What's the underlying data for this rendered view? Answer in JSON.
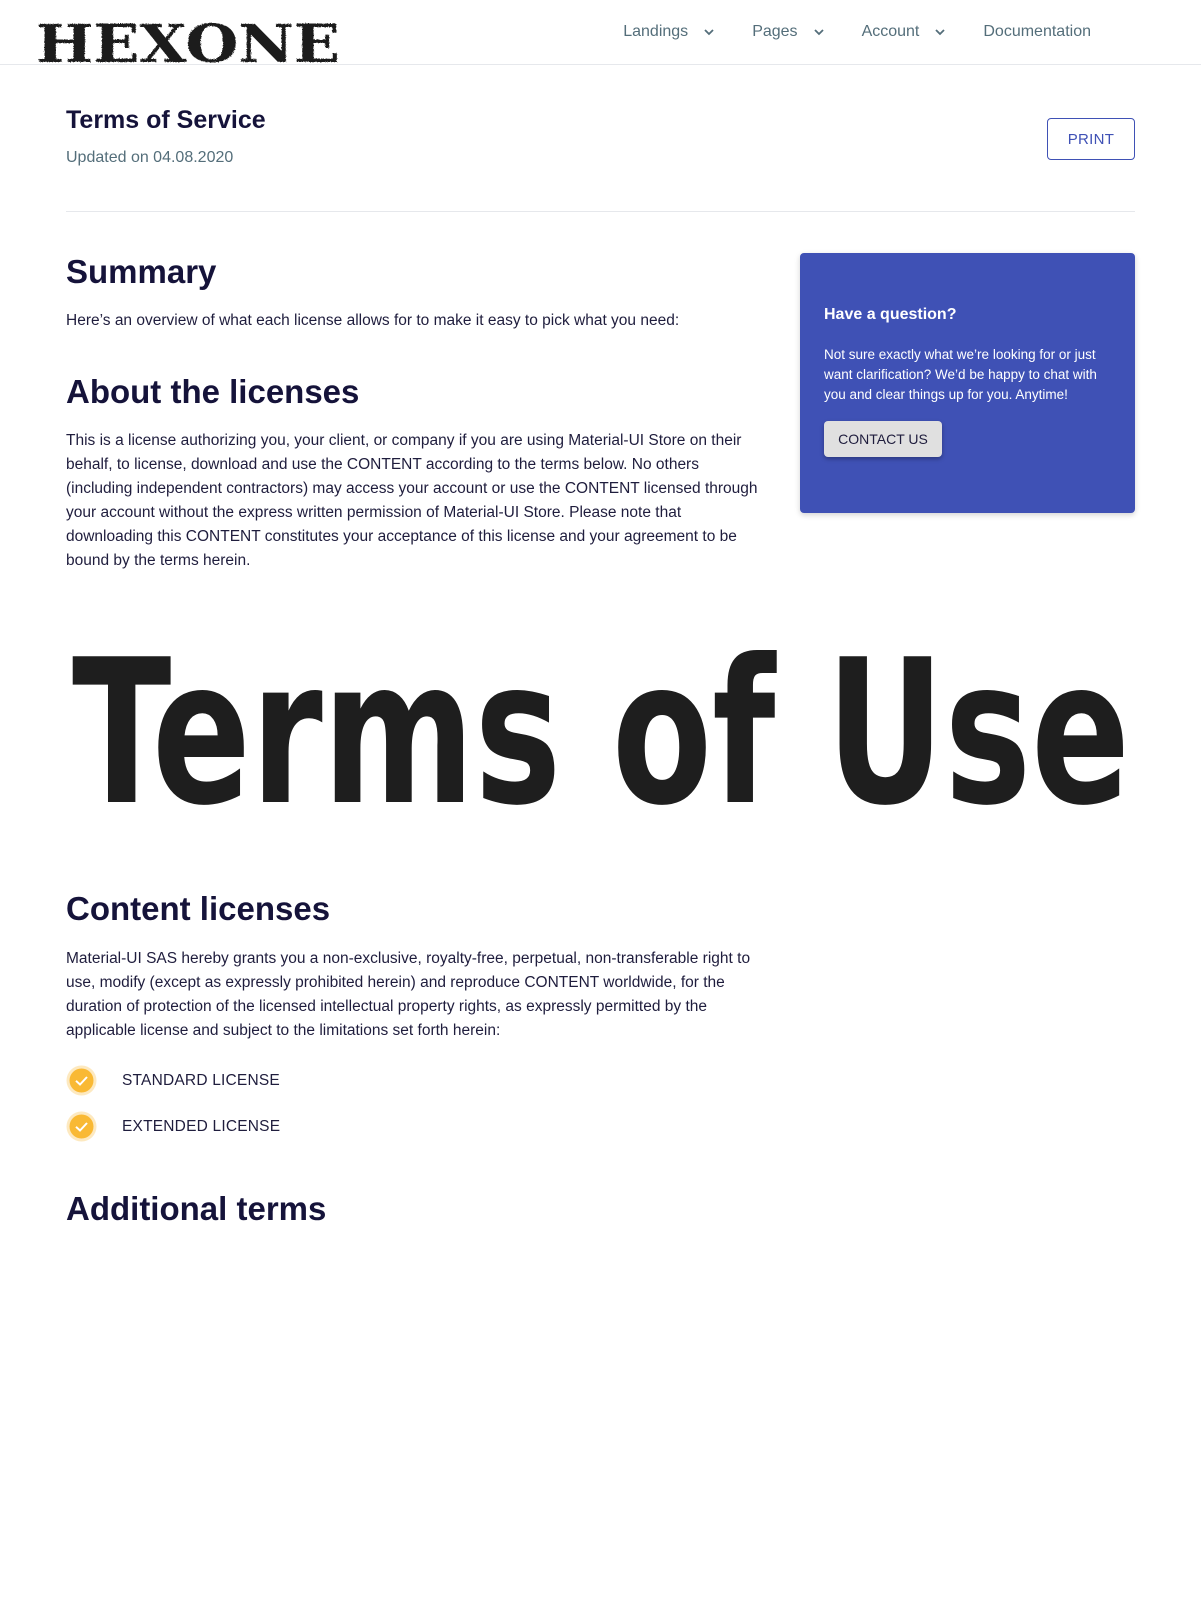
{
  "header": {
    "logo_text": "HEXONE",
    "nav": [
      {
        "label": "Landings",
        "has_dropdown": true,
        "icon": "chevron-down-icon"
      },
      {
        "label": "Pages",
        "has_dropdown": true,
        "icon": "chevron-down-icon"
      },
      {
        "label": "Account",
        "has_dropdown": true,
        "icon": "chevron-down-icon"
      },
      {
        "label": "Documentation",
        "has_dropdown": false
      }
    ]
  },
  "page": {
    "title": "Terms of Service",
    "updated": "Updated on 04.08.2020",
    "print_label": "PRINT"
  },
  "summary": {
    "heading": "Summary",
    "text": "Here’s an overview of what each license allows for to make it easy to pick what you need:"
  },
  "about": {
    "heading": "About the licenses",
    "text": "This is a license authorizing you, your client, or company if you are using Material-UI Store on their behalf, to license, download and use the CONTENT according to the terms below. No others (including independent contractors) may access your account or use the CONTENT licensed through your account without the express written permission of Material-UI Store. Please note that downloading this CONTENT constitutes your acceptance of this license and your agreement to be bound by the terms herein."
  },
  "sidebar": {
    "title": "Have a question?",
    "text": "Not sure exactly what we’re looking for or just want clarification? We’d be happy to chat with you and clear things up for you. Anytime!",
    "button_label": "CONTACT US"
  },
  "banner": {
    "text": "Terms of Use"
  },
  "content_licenses": {
    "heading": "Content licenses",
    "text": "Material-UI SAS hereby grants you a non-exclusive, royalty-free, perpetual, non-transferable right to use, modify (except as expressly prohibited herein) and reproduce CONTENT worldwide, for the duration of protection of the licensed intellectual property rights, as expressly permitted by the applicable license and subject to the limitations set forth herein:",
    "items": [
      {
        "label": "STANDARD LICENSE",
        "icon": "check-circle-icon"
      },
      {
        "label": "EXTENDED LICENSE",
        "icon": "check-circle-icon"
      }
    ]
  },
  "additional": {
    "heading": "Additional terms"
  },
  "colors": {
    "primary": "#3f51b5",
    "heading": "#15133a",
    "muted": "#546e7a",
    "check": "#f9b934",
    "banner_text": "#1e1e1e"
  }
}
